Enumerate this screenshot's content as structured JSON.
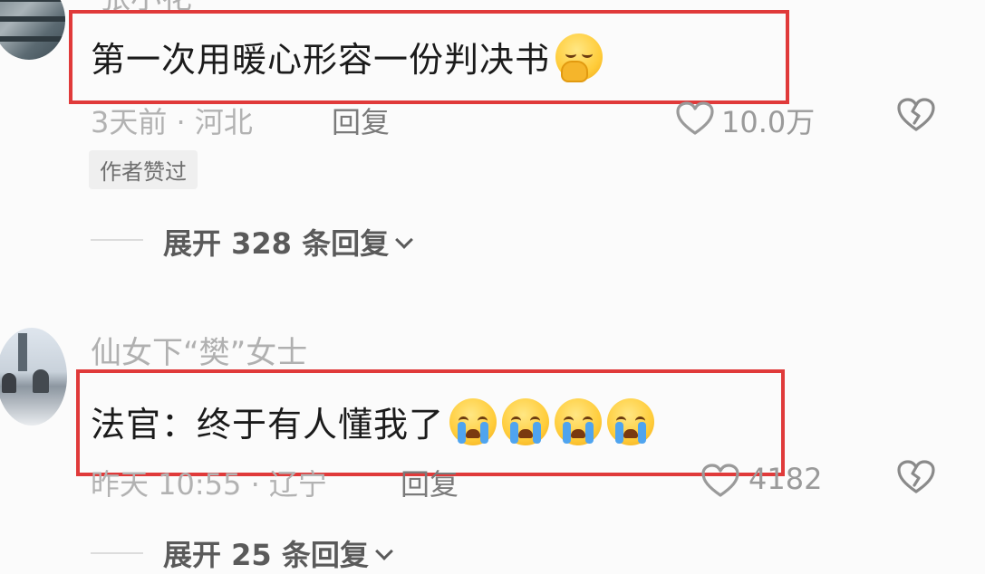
{
  "comments": [
    {
      "username": "张小花",
      "text": "第一次用暖心形容一份判决书",
      "emojis": [
        "shy-face-emoji"
      ],
      "time_location": "3天前 · 河北",
      "reply_label": "回复",
      "like_count": "10.0万",
      "author_liked_badge": "作者赞过",
      "expand_replies": "展开 328 条回复"
    },
    {
      "username": "仙女下“樊”女士",
      "text": "法官：终于有人懂我了",
      "emojis": [
        "crying-face-emoji",
        "crying-face-emoji",
        "crying-face-emoji",
        "crying-face-emoji"
      ],
      "time_location": "昨天 10:55 · 辽宁",
      "reply_label": "回复",
      "like_count": "4182",
      "expand_replies": "展开 25 条回复"
    }
  ],
  "colors": {
    "highlight_box": "#e03a3a",
    "background": "#fbfbfb",
    "meta_text": "#b2b2b2"
  },
  "icons": [
    "heart-outline-icon",
    "broken-heart-icon",
    "chevron-down-icon"
  ]
}
